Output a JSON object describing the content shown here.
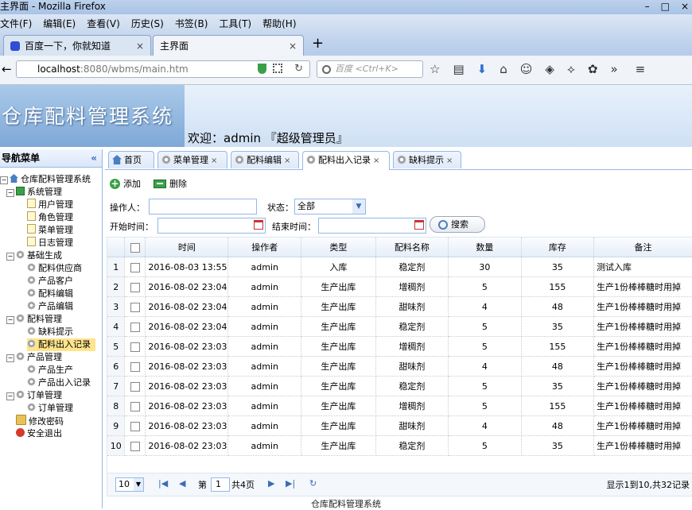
{
  "browser": {
    "window_title": "主界面 - Mozilla Firefox",
    "menu": [
      "文件(F)",
      "编辑(E)",
      "查看(V)",
      "历史(S)",
      "书签(B)",
      "工具(T)",
      "帮助(H)"
    ],
    "tabs": [
      {
        "label": "百度一下，你就知道",
        "close": "×"
      },
      {
        "label": "主界面",
        "close": "×"
      }
    ],
    "new_tab": "+",
    "url_host": "localhost",
    "url_rest": ":8080/wbms/main.htm",
    "search_placeholder": "百度 <Ctrl+K>",
    "win_ctrls": [
      "–",
      "□",
      "×"
    ]
  },
  "app": {
    "title": "仓库配料管理系统",
    "welcome": "欢迎：admin 『超级管理员』",
    "footer": "仓库配料管理系统"
  },
  "sidebar": {
    "header": "导航菜单",
    "collapse": "«",
    "root": "仓库配料管理系统",
    "groups": [
      {
        "label": "系统管理",
        "items": [
          "用户管理",
          "角色管理",
          "菜单管理",
          "日志管理"
        ]
      },
      {
        "label": "基础生成",
        "items": [
          "配料供应商",
          "产品客户",
          "配料编辑",
          "产品编辑"
        ]
      },
      {
        "label": "配料管理",
        "items": [
          "缺料提示",
          "配料出入记录"
        ]
      },
      {
        "label": "产品管理",
        "items": [
          "产品生产",
          "产品出入记录"
        ]
      },
      {
        "label": "订单管理",
        "items": [
          "订单管理"
        ]
      }
    ],
    "extra": [
      "修改密码",
      "安全退出"
    ]
  },
  "tabs": [
    {
      "label": "首页",
      "close": ""
    },
    {
      "label": "菜单管理",
      "close": "×"
    },
    {
      "label": "配料编辑",
      "close": "×"
    },
    {
      "label": "配料出入记录",
      "close": "×"
    },
    {
      "label": "缺料提示",
      "close": "×"
    }
  ],
  "toolbar": {
    "add": "添加",
    "delete": "删除"
  },
  "filters": {
    "operator_label": "操作人：",
    "status_label": "状态：",
    "status_value": "全部",
    "start_label": "开始时间：",
    "end_label": "结束时间：",
    "search": "搜索"
  },
  "table": {
    "columns": [
      "时间",
      "操作者",
      "类型",
      "配料名称",
      "数量",
      "库存",
      "备注"
    ],
    "rows": [
      [
        "1",
        "2016-08-03 13:55",
        "admin",
        "入库",
        "稳定剂",
        "30",
        "35",
        "测试入库"
      ],
      [
        "2",
        "2016-08-02 23:04",
        "admin",
        "生产出库",
        "增稠剂",
        "5",
        "155",
        "生产1份棒棒糖时用掉"
      ],
      [
        "3",
        "2016-08-02 23:04",
        "admin",
        "生产出库",
        "甜味剂",
        "4",
        "48",
        "生产1份棒棒糖时用掉"
      ],
      [
        "4",
        "2016-08-02 23:04",
        "admin",
        "生产出库",
        "稳定剂",
        "5",
        "35",
        "生产1份棒棒糖时用掉"
      ],
      [
        "5",
        "2016-08-02 23:03",
        "admin",
        "生产出库",
        "增稠剂",
        "5",
        "155",
        "生产1份棒棒糖时用掉"
      ],
      [
        "6",
        "2016-08-02 23:03",
        "admin",
        "生产出库",
        "甜味剂",
        "4",
        "48",
        "生产1份棒棒糖时用掉"
      ],
      [
        "7",
        "2016-08-02 23:03",
        "admin",
        "生产出库",
        "稳定剂",
        "5",
        "35",
        "生产1份棒棒糖时用掉"
      ],
      [
        "8",
        "2016-08-02 23:03",
        "admin",
        "生产出库",
        "增稠剂",
        "5",
        "155",
        "生产1份棒棒糖时用掉"
      ],
      [
        "9",
        "2016-08-02 23:03",
        "admin",
        "生产出库",
        "甜味剂",
        "4",
        "48",
        "生产1份棒棒糖时用掉"
      ],
      [
        "10",
        "2016-08-02 23:03",
        "admin",
        "生产出库",
        "稳定剂",
        "5",
        "35",
        "生产1份棒棒糖时用掉"
      ]
    ]
  },
  "pager": {
    "page_size": "10",
    "page_prefix": "第",
    "page_num": "1",
    "page_total": "共4页",
    "summary": "显示1到10,共32记录"
  }
}
